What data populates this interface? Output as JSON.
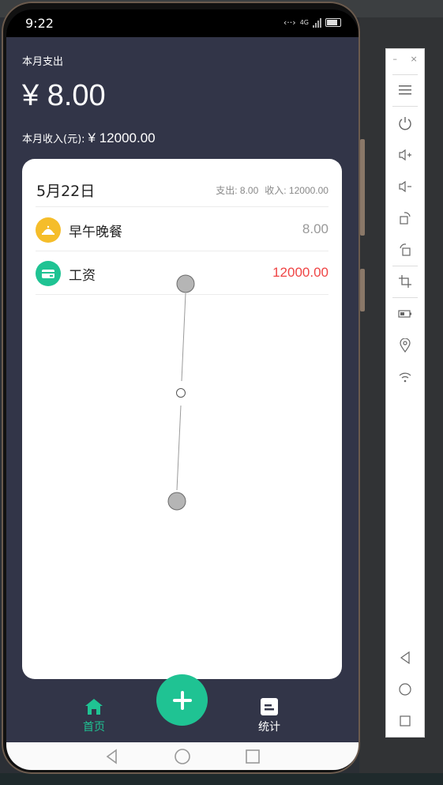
{
  "status": {
    "time": "9:22",
    "network": "4G"
  },
  "summary": {
    "month_expense_label": "本月支出",
    "month_expense_amount": "¥ 8.00",
    "month_income_label": "本月收入(元):",
    "month_income_amount": "¥ 12000.00"
  },
  "card": {
    "date": "5月22日",
    "expense_summary": "支出: 8.00",
    "income_summary": "收入: 12000.00",
    "records": [
      {
        "label": "早午晚餐",
        "amount": "8.00",
        "icon": "meal-bell-icon",
        "icon_color": "#f5bd2a",
        "amount_color": "#999999"
      },
      {
        "label": "工资",
        "amount": "12000.00",
        "icon": "salary-card-icon",
        "icon_color": "#1fc393",
        "amount_color": "#ef4444"
      }
    ]
  },
  "nav": {
    "home_label": "首页",
    "stats_label": "统计",
    "active_color": "#1fc393"
  },
  "colors": {
    "background": "#323548",
    "accent": "#1fc393",
    "expense_red": "#ef4444"
  }
}
